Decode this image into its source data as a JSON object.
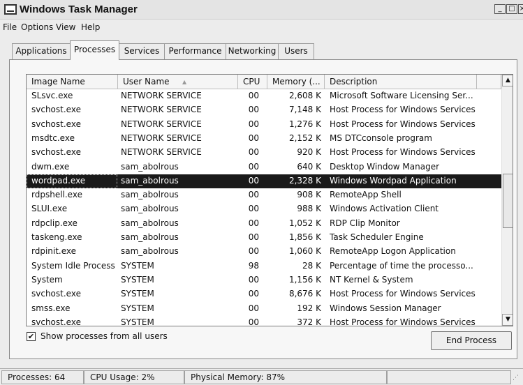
{
  "window": {
    "title": "Windows Task Manager",
    "min": "_",
    "max": "□",
    "close": "×"
  },
  "menu": [
    "File",
    "Options",
    "View",
    "Help"
  ],
  "tabs": [
    {
      "label": "Applications"
    },
    {
      "label": "Processes"
    },
    {
      "label": "Services"
    },
    {
      "label": "Performance"
    },
    {
      "label": "Networking"
    },
    {
      "label": "Users"
    }
  ],
  "columns": {
    "image": "Image Name",
    "user": "User Name",
    "cpu": "CPU",
    "memory": "Memory (...",
    "description": "Description"
  },
  "processes": [
    {
      "image": "SLsvc.exe",
      "user": "NETWORK SERVICE",
      "cpu": "00",
      "memory": "2,608 K",
      "description": "Microsoft Software Licensing Ser..."
    },
    {
      "image": "svchost.exe",
      "user": "NETWORK SERVICE",
      "cpu": "00",
      "memory": "7,148 K",
      "description": "Host Process for Windows Services"
    },
    {
      "image": "svchost.exe",
      "user": "NETWORK SERVICE",
      "cpu": "00",
      "memory": "1,276 K",
      "description": "Host Process for Windows Services"
    },
    {
      "image": "msdtc.exe",
      "user": "NETWORK SERVICE",
      "cpu": "00",
      "memory": "2,152 K",
      "description": "MS DTCconsole program"
    },
    {
      "image": "svchost.exe",
      "user": "NETWORK SERVICE",
      "cpu": "00",
      "memory": "920 K",
      "description": "Host Process for Windows Services"
    },
    {
      "image": "dwm.exe",
      "user": "sam_abolrous",
      "cpu": "00",
      "memory": "640 K",
      "description": "Desktop Window Manager"
    },
    {
      "image": "wordpad.exe",
      "user": "sam_abolrous",
      "cpu": "00",
      "memory": "2,328 K",
      "description": "Windows Wordpad Application",
      "selected": true
    },
    {
      "image": "rdpshell.exe",
      "user": "sam_abolrous",
      "cpu": "00",
      "memory": "908 K",
      "description": "RemoteApp Shell"
    },
    {
      "image": "SLUI.exe",
      "user": "sam_abolrous",
      "cpu": "00",
      "memory": "988 K",
      "description": "Windows Activation Client"
    },
    {
      "image": "rdpclip.exe",
      "user": "sam_abolrous",
      "cpu": "00",
      "memory": "1,052 K",
      "description": "RDP Clip Monitor"
    },
    {
      "image": "taskeng.exe",
      "user": "sam_abolrous",
      "cpu": "00",
      "memory": "1,856 K",
      "description": "Task Scheduler Engine"
    },
    {
      "image": "rdpinit.exe",
      "user": "sam_abolrous",
      "cpu": "00",
      "memory": "1,060 K",
      "description": "RemoteApp Logon Application"
    },
    {
      "image": "System Idle Process",
      "user": "SYSTEM",
      "cpu": "98",
      "memory": "28 K",
      "description": "Percentage of time the processo..."
    },
    {
      "image": "System",
      "user": "SYSTEM",
      "cpu": "00",
      "memory": "1,156 K",
      "description": "NT Kernel & System"
    },
    {
      "image": "svchost.exe",
      "user": "SYSTEM",
      "cpu": "00",
      "memory": "8,676 K",
      "description": "Host Process for Windows Services"
    },
    {
      "image": "smss.exe",
      "user": "SYSTEM",
      "cpu": "00",
      "memory": "192 K",
      "description": "Windows Session Manager"
    },
    {
      "image": "svchost.exe",
      "user": "SYSTEM",
      "cpu": "00",
      "memory": "372 K",
      "description": "Host Process for Windows Services"
    }
  ],
  "show_all": {
    "label": "Show processes from all users",
    "checked": true,
    "mark": "✔"
  },
  "end_button": "End Process",
  "status": {
    "processes": "Processes: 64",
    "cpu": "CPU Usage: 2%",
    "memory": "Physical Memory: 87%"
  }
}
